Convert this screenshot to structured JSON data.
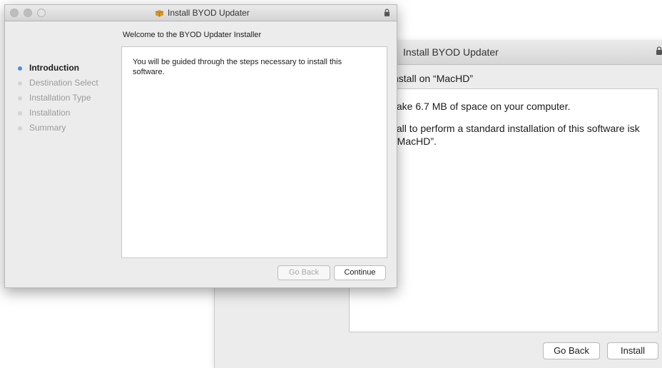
{
  "back_window": {
    "title": "Install BYOD Updater",
    "heading": "nstall on “MacHD”",
    "body_line1": "take 6.7 MB of space on your computer.",
    "body_line2": "tall to perform a standard installation of this software isk “MacHD”.",
    "go_back_label": "Go Back",
    "install_label": "Install"
  },
  "front_window": {
    "title": "Install BYOD Updater",
    "heading": "Welcome to the BYOD Updater Installer",
    "steps": [
      {
        "label": "Introduction",
        "active": true
      },
      {
        "label": "Destination Select",
        "active": false
      },
      {
        "label": "Installation Type",
        "active": false
      },
      {
        "label": "Installation",
        "active": false
      },
      {
        "label": "Summary",
        "active": false
      }
    ],
    "body": "You will be guided through the steps necessary to install this software.",
    "go_back_label": "Go Back",
    "continue_label": "Continue"
  },
  "colors": {
    "active_step_dot": "#4a90e2",
    "inactive_step_text": "#9b9b9b",
    "window_bg": "#ececec"
  },
  "icons": {
    "package": "package-icon",
    "lock": "lock-icon"
  }
}
